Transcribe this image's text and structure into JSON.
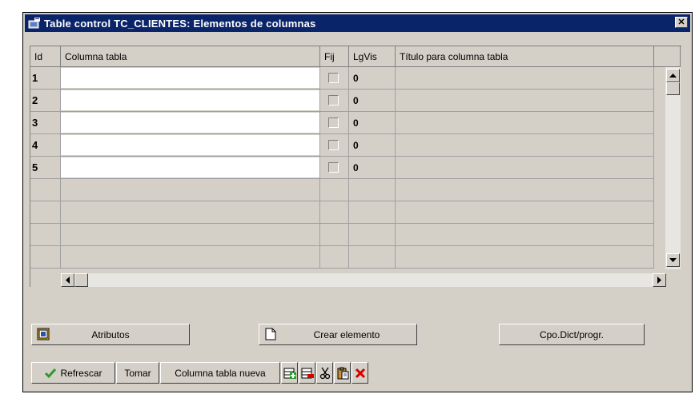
{
  "window": {
    "title": "Table control TC_CLIENTES: Elementos de columnas",
    "close_label": "✕"
  },
  "table": {
    "headers": {
      "id": "Id",
      "columna": "Columna tabla",
      "fij": "Fij",
      "lgvis": "LgVis",
      "titulo": "Título para columna tabla"
    },
    "rows": [
      {
        "id": "1",
        "columna": "",
        "fij": false,
        "lgvis": "0",
        "titulo": ""
      },
      {
        "id": "2",
        "columna": "",
        "fij": false,
        "lgvis": "0",
        "titulo": ""
      },
      {
        "id": "3",
        "columna": "",
        "fij": false,
        "lgvis": "0",
        "titulo": ""
      },
      {
        "id": "4",
        "columna": "",
        "fij": false,
        "lgvis": "0",
        "titulo": ""
      },
      {
        "id": "5",
        "columna": "",
        "fij": false,
        "lgvis": "0",
        "titulo": ""
      },
      {
        "id": "",
        "columna": "",
        "lgvis": "",
        "titulo": ""
      },
      {
        "id": "",
        "columna": "",
        "lgvis": "",
        "titulo": ""
      },
      {
        "id": "",
        "columna": "",
        "lgvis": "",
        "titulo": ""
      },
      {
        "id": "",
        "columna": "",
        "lgvis": "",
        "titulo": ""
      }
    ]
  },
  "actions": {
    "atributos": "Atributos",
    "crear_elemento": "Crear elemento",
    "cpo_dict": "Cpo.Dict/progr."
  },
  "toolbar": {
    "refrescar": "Refrescar",
    "tomar": "Tomar",
    "columna_nueva": "Columna tabla nueva"
  },
  "colors": {
    "titlebar": "#0a246a",
    "window_bg": "#d4d0c8",
    "delete_red": "#d40000",
    "check_green": "#2a9a2a"
  }
}
